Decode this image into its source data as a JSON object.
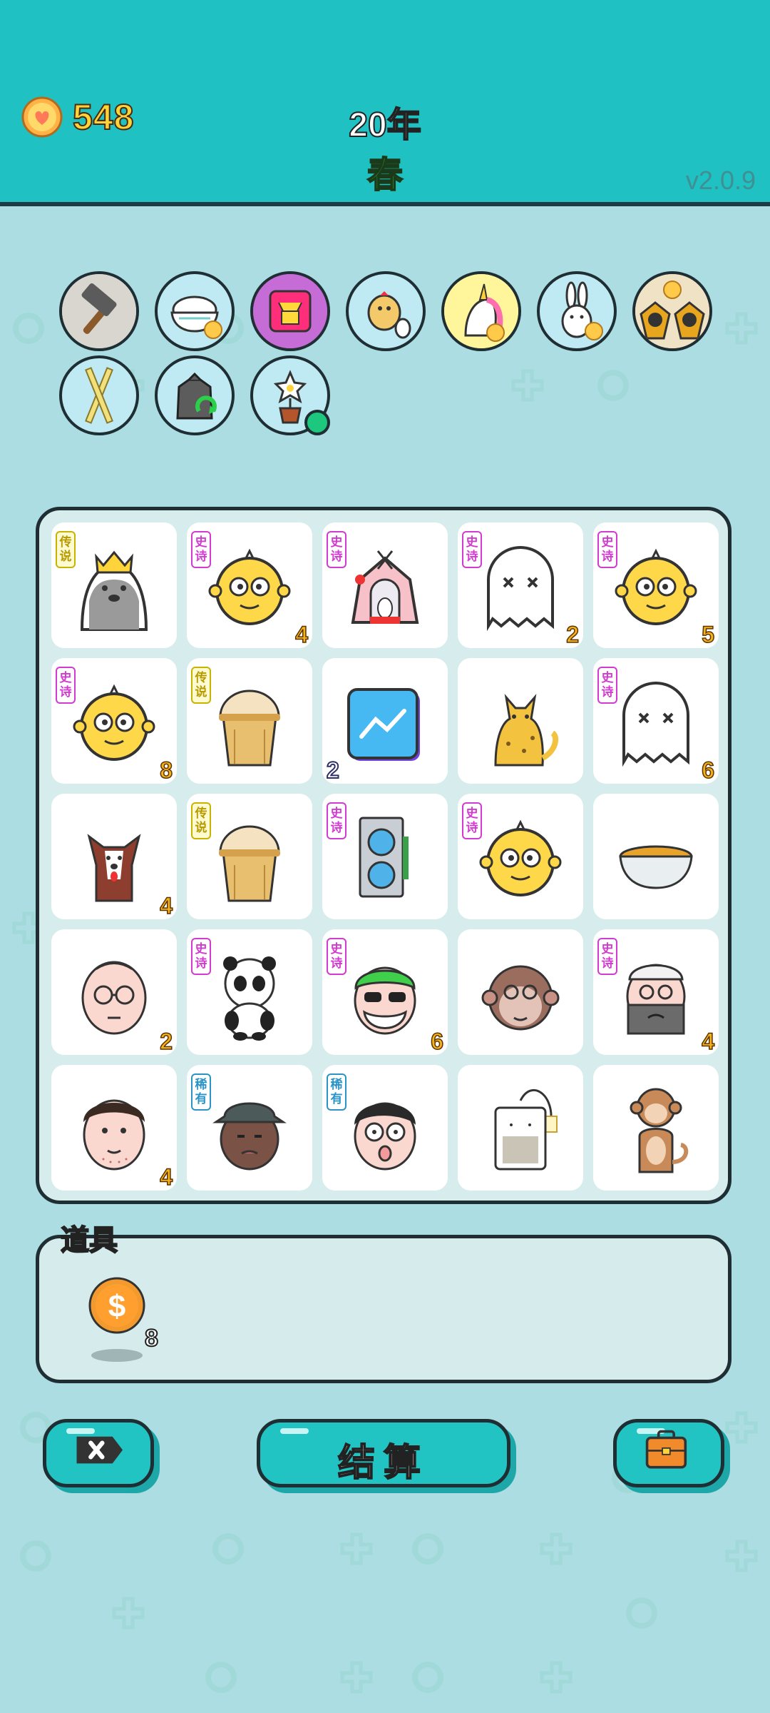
{
  "header": {
    "coins": "548",
    "year": "20年",
    "season": "春",
    "version": "v2.0.9",
    "coin_icon": "heart-coin-icon"
  },
  "tools": [
    {
      "name": "hammer-icon"
    },
    {
      "name": "rice-bowl-icon",
      "badge": "heart-coin"
    },
    {
      "name": "bull-card-icon"
    },
    {
      "name": "chick-egg-icon"
    },
    {
      "name": "unicorn-icon",
      "badge": "heart-coin"
    },
    {
      "name": "bunny-icon",
      "badge": "heart-coin"
    },
    {
      "name": "owls-icon",
      "badge": "heart-coin"
    },
    {
      "name": "crossed-sticks-icon"
    },
    {
      "name": "recycle-bag-icon"
    },
    {
      "name": "potted-flower-icon",
      "status": "active-dot"
    }
  ],
  "rarity_labels": {
    "epic": "史诗",
    "legend": "传说",
    "rare": "稀有"
  },
  "board": [
    {
      "symbol": "husky-king",
      "rarity": "legend",
      "count": ""
    },
    {
      "symbol": "yellow-chick-face",
      "rarity": "epic",
      "count": "4"
    },
    {
      "symbol": "cat-house",
      "rarity": "epic",
      "count": ""
    },
    {
      "symbol": "ghost",
      "rarity": "epic",
      "count": "2"
    },
    {
      "symbol": "yellow-chick-face",
      "rarity": "epic",
      "count": "5"
    },
    {
      "symbol": "yellow-chick-face",
      "rarity": "epic",
      "count": "8"
    },
    {
      "symbol": "milk-tea-cup",
      "rarity": "legend",
      "count": ""
    },
    {
      "symbol": "stock-chart-app",
      "rarity": "",
      "count": "2",
      "count_side": "left"
    },
    {
      "symbol": "leopard-cat",
      "rarity": "",
      "count": ""
    },
    {
      "symbol": "ghost",
      "rarity": "epic",
      "count": "6"
    },
    {
      "symbol": "brown-dog",
      "rarity": "",
      "count": "4"
    },
    {
      "symbol": "milk-tea-cup",
      "rarity": "legend",
      "count": ""
    },
    {
      "symbol": "graphics-card",
      "rarity": "epic",
      "count": ""
    },
    {
      "symbol": "yellow-chick-face",
      "rarity": "epic",
      "count": ""
    },
    {
      "symbol": "soup-bowl",
      "rarity": "",
      "count": ""
    },
    {
      "symbol": "bald-man",
      "rarity": "",
      "count": "2"
    },
    {
      "symbol": "panda",
      "rarity": "epic",
      "count": ""
    },
    {
      "symbol": "green-hair-grandpa",
      "rarity": "epic",
      "count": "6"
    },
    {
      "symbol": "monkey-face",
      "rarity": "",
      "count": ""
    },
    {
      "symbol": "masked-man",
      "rarity": "epic",
      "count": "4"
    },
    {
      "symbol": "stubble-man",
      "rarity": "",
      "count": "4"
    },
    {
      "symbol": "bucket-hat-man",
      "rarity": "rare",
      "count": ""
    },
    {
      "symbol": "glasses-boy",
      "rarity": "rare",
      "count": ""
    },
    {
      "symbol": "tea-bag",
      "rarity": "",
      "count": ""
    },
    {
      "symbol": "monkey",
      "rarity": "",
      "count": ""
    }
  ],
  "items": {
    "title": "道具",
    "entries": [
      {
        "name": "dollar-coin-icon",
        "count": "8"
      }
    ]
  },
  "buttons": {
    "exit_icon": "close-tag-icon",
    "settle_label": "结算",
    "bag_icon": "briefcase-icon"
  },
  "colors": {
    "header_bg": "#20c1c2",
    "page_bg": "#abdde3",
    "coin_text": "#ffd43a",
    "season_text": "#2fd33b",
    "epic": "#d23bd0",
    "legend": "#c9b200",
    "rare": "#2b94c7",
    "count_text": "#f6b21b"
  }
}
